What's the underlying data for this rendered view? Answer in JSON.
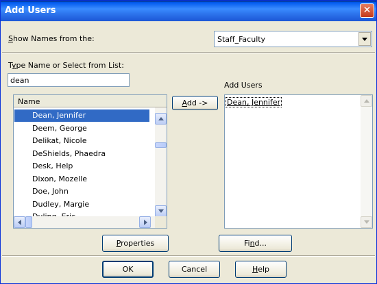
{
  "window": {
    "title": "Add Users",
    "close_glyph": "✕"
  },
  "source": {
    "label_prefix": "",
    "label_hotkey": "S",
    "label_rest": "how Names from the:",
    "selected": "Staff_Faculty"
  },
  "search": {
    "label_prefix": "T",
    "label_hotkey": "y",
    "label_rest": "pe Name or Select from List:",
    "value": "dean"
  },
  "name_list": {
    "header": "Name",
    "rows": [
      "Dean, Jennifer",
      "Deem, George",
      "Delikat, Nicole",
      "DeShields, Phaedra",
      "Desk, Help",
      "Dixon, Mozelle",
      "Doe, John",
      "Dudley, Margie",
      "Duling, Eric"
    ],
    "selected_index": 0
  },
  "add_button": {
    "hotkey": "A",
    "rest": "dd ->"
  },
  "added": {
    "label": "Add Users",
    "items": [
      "Dean, Jennifer"
    ]
  },
  "properties_button": {
    "prefix": "",
    "hotkey": "P",
    "rest": "roperties"
  },
  "find_button": {
    "prefix": "Fi",
    "hotkey": "n",
    "rest": "d..."
  },
  "ok_button": {
    "label": "OK"
  },
  "cancel_button": {
    "label": "Cancel"
  },
  "help_button": {
    "prefix": "",
    "hotkey": "H",
    "rest": "elp"
  },
  "colors": {
    "titlebar": "#0058ee",
    "selection": "#316ac5",
    "face": "#ece9d8"
  }
}
